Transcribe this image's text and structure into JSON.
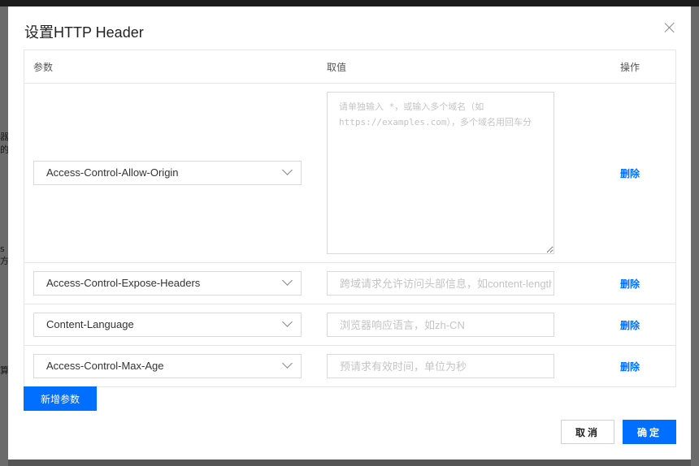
{
  "background": {
    "fragments": [
      "器的",
      "s方",
      "算"
    ]
  },
  "dialog": {
    "title": "设置HTTP Header"
  },
  "table": {
    "headers": [
      "参数",
      "取值",
      "操作"
    ],
    "rows": [
      {
        "param": "Access-Control-Allow-Origin",
        "value": "",
        "placeholder": "请单独输入 *，或输入多个域名（如 https://examples.com），多个域名用回车分",
        "action": "删除"
      },
      {
        "param": "Access-Control-Expose-Headers",
        "value": "",
        "placeholder": "跨域请求允许访问头部信息，如content-length",
        "action": "删除"
      },
      {
        "param": "Content-Language",
        "value": "",
        "placeholder": "浏览器响应语言，如zh-CN",
        "action": "删除"
      },
      {
        "param": "Access-Control-Max-Age",
        "value": "",
        "placeholder": "预请求有效时间，单位为秒",
        "action": "删除"
      }
    ]
  },
  "buttons": {
    "add": "新增参数",
    "cancel": "取消",
    "confirm": "确定"
  },
  "colors": {
    "primary": "#006eff",
    "border": "#e5e5e5",
    "overlay": "#555555"
  }
}
